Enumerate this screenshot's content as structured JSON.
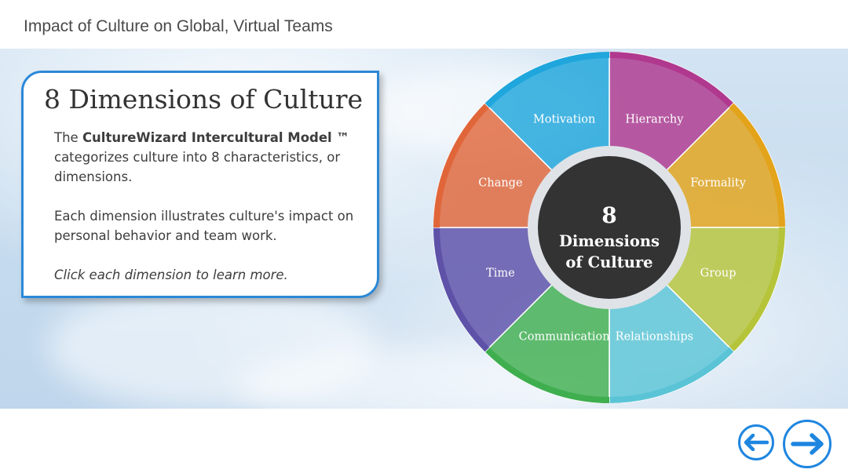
{
  "page": {
    "title": "Impact of Culture on Global, Virtual Teams"
  },
  "card": {
    "heading": "8 Dimensions of Culture",
    "para1_prefix": "The ",
    "para1_bold": "CultureWizard Intercultural Model ™",
    "para1_suffix": " categorizes culture into 8 characteristics, or dimensions.",
    "para2": "Each dimension illustrates culture's impact on personal behavior and team work.",
    "hint": "Click each dimension to learn more."
  },
  "wheel": {
    "center_number": "8",
    "center_line1": "Dimensions",
    "center_line2": "of Culture",
    "dimensions": [
      {
        "label": "Hierarchy",
        "color": "#b0398f"
      },
      {
        "label": "Formality",
        "color": "#e3a31a"
      },
      {
        "label": "Group",
        "color": "#b6c43a"
      },
      {
        "label": "Relationships",
        "color": "#5ac4d6"
      },
      {
        "label": "Communication",
        "color": "#3fae4f"
      },
      {
        "label": "Time",
        "color": "#5d51a8"
      },
      {
        "label": "Change",
        "color": "#e0663a"
      },
      {
        "label": "Motivation",
        "color": "#1fa6dc"
      }
    ]
  },
  "nav": {
    "prev_icon": "arrow-left-icon",
    "next_icon": "arrow-right-icon",
    "accent": "#1f86e0"
  }
}
